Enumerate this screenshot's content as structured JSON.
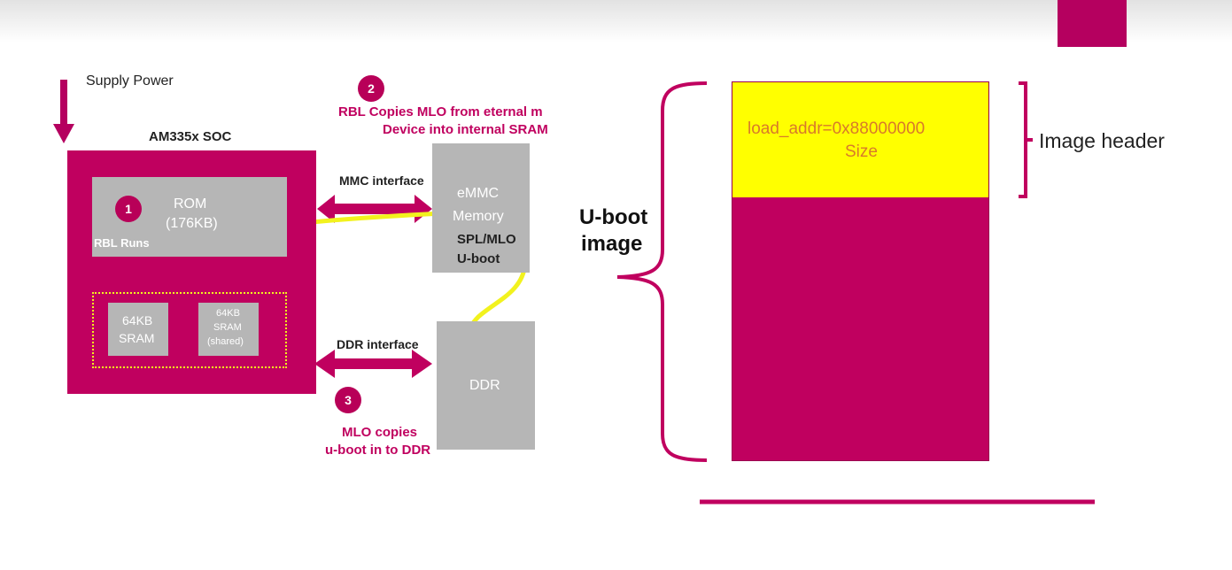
{
  "left": {
    "supply_power": "Supply Power",
    "soc_title": "AM335x SOC",
    "rom": {
      "label": "ROM",
      "size": "(176KB)",
      "badge": "1",
      "status": "RBL Runs"
    },
    "sram1": {
      "size": "64KB",
      "label": "SRAM"
    },
    "sram2": {
      "size": "64KB",
      "label": "SRAM",
      "note": "(shared)"
    },
    "step2": {
      "badge": "2",
      "line1": "RBL Copies MLO  from eternal m",
      "line2": "Device into internal SRAM"
    },
    "mmc_interface": "MMC interface",
    "emmc": {
      "line1": "eMMC",
      "line2": "Memory",
      "line3": "SPL/MLO",
      "line4": "U-boot"
    },
    "ddr_interface": "DDR interface",
    "ddr": "DDR",
    "step3": {
      "badge": "3",
      "line1": "MLO copies",
      "line2": "u-boot in to DDR"
    }
  },
  "right": {
    "uboot_label_1": "U-boot",
    "uboot_label_2": "image",
    "header_line1": "load_addr=0x88000000",
    "header_line2": "Size",
    "image_header_label": "Image header"
  },
  "colors": {
    "magenta": "#c0005f",
    "yellow": "#ffff00",
    "grey": "#b6b6b6",
    "arrow_yellow": "#f2f21e"
  }
}
